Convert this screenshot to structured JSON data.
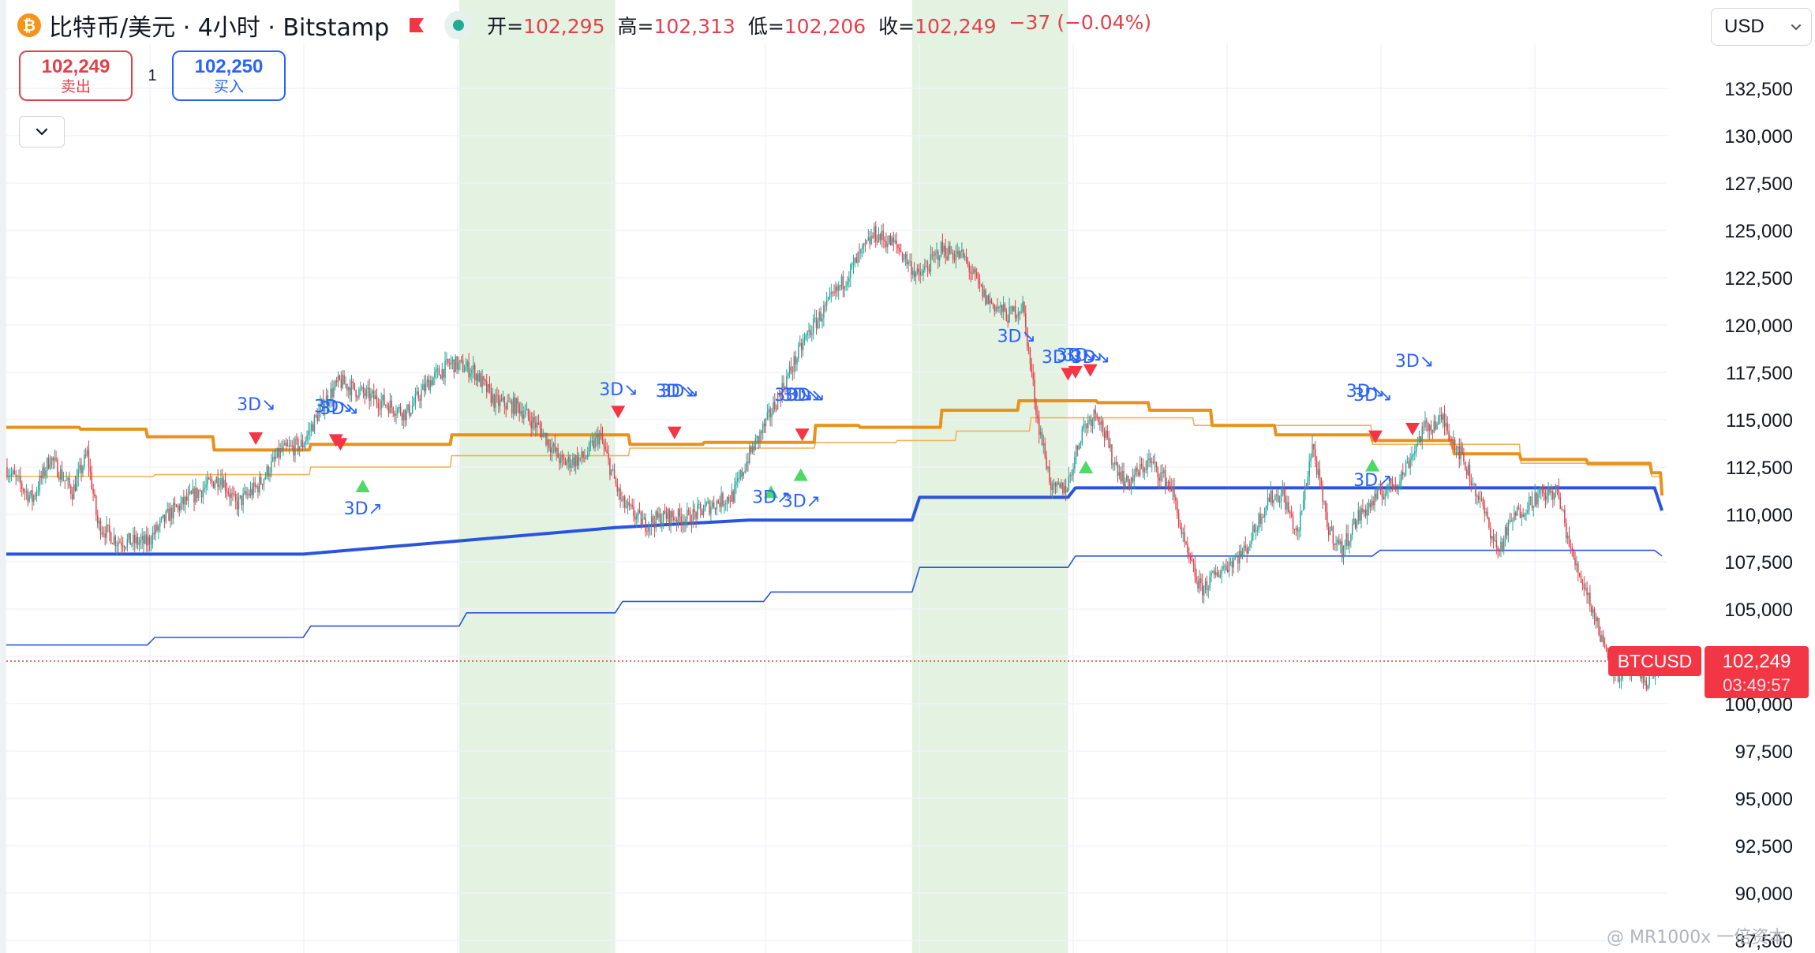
{
  "header": {
    "coin_icon": "bitcoin-icon",
    "title": "比特币/美元 · 4小时 · Bitstamp",
    "open_label": "开=",
    "open": "102,295",
    "high_label": "高=",
    "high": "102,313",
    "low_label": "低=",
    "low": "102,206",
    "close_label": "收=",
    "close": "102,249",
    "change": "−37 (−0.04%)"
  },
  "trade": {
    "sell_price": "102,249",
    "sell_label": "卖出",
    "spread": "1",
    "buy_price": "102,250",
    "buy_label": "买入"
  },
  "currency": "USD",
  "watermark": "@ MR1000x 一倍资本",
  "colors": {
    "up": "#26a69a",
    "down": "#e2404a",
    "orange": "#e8921c",
    "blue": "#2954e0",
    "highlight": "#e3f2e1"
  },
  "chart_data": {
    "type": "candlestick",
    "symbol": "BTCUSD",
    "y_axis_ticks": [
      "132,500",
      "130,000",
      "127,500",
      "125,000",
      "122,500",
      "120,000",
      "117,500",
      "115,000",
      "112,500",
      "110,000",
      "107,500",
      "105,000",
      "102,500",
      "100,000",
      "97,500",
      "95,000",
      "92,500",
      "90,000",
      "87,500"
    ],
    "ylim": [
      87500,
      133500
    ],
    "last_price": {
      "label": "BTCUSD",
      "value": "102,249",
      "countdown": "03:49:57",
      "price": 102249
    },
    "anchors": [
      [
        0,
        112500
      ],
      [
        18,
        110800
      ],
      [
        30,
        113000
      ],
      [
        45,
        111200
      ],
      [
        55,
        113200
      ],
      [
        62,
        109500
      ],
      [
        75,
        108600
      ],
      [
        95,
        108500
      ],
      [
        110,
        110000
      ],
      [
        130,
        111200
      ],
      [
        145,
        112000
      ],
      [
        155,
        110500
      ],
      [
        170,
        111500
      ],
      [
        185,
        113300
      ],
      [
        200,
        113700
      ],
      [
        215,
        116000
      ],
      [
        225,
        117000
      ],
      [
        240,
        116400
      ],
      [
        255,
        115900
      ],
      [
        270,
        115300
      ],
      [
        285,
        117000
      ],
      [
        300,
        118000
      ],
      [
        315,
        117600
      ],
      [
        330,
        115900
      ],
      [
        345,
        115700
      ],
      [
        360,
        114500
      ],
      [
        375,
        112700
      ],
      [
        390,
        113000
      ],
      [
        400,
        114200
      ],
      [
        415,
        110600
      ],
      [
        430,
        109500
      ],
      [
        445,
        109900
      ],
      [
        460,
        109800
      ],
      [
        475,
        110500
      ],
      [
        490,
        111000
      ],
      [
        500,
        113000
      ],
      [
        512,
        114800
      ],
      [
        525,
        117000
      ],
      [
        540,
        119500
      ],
      [
        555,
        121200
      ],
      [
        570,
        123000
      ],
      [
        585,
        124800
      ],
      [
        600,
        124200
      ],
      [
        615,
        122500
      ],
      [
        630,
        124000
      ],
      [
        645,
        123600
      ],
      [
        660,
        121400
      ],
      [
        675,
        120500
      ],
      [
        685,
        121000
      ],
      [
        695,
        115000
      ],
      [
        705,
        111200
      ],
      [
        715,
        111500
      ],
      [
        725,
        114500
      ],
      [
        735,
        115500
      ],
      [
        745,
        113000
      ],
      [
        755,
        111600
      ],
      [
        770,
        112800
      ],
      [
        785,
        111500
      ],
      [
        795,
        108000
      ],
      [
        805,
        106000
      ],
      [
        820,
        107200
      ],
      [
        835,
        108100
      ],
      [
        850,
        110800
      ],
      [
        860,
        111100
      ],
      [
        870,
        108800
      ],
      [
        880,
        113700
      ],
      [
        890,
        109400
      ],
      [
        900,
        108100
      ],
      [
        910,
        109800
      ],
      [
        925,
        111000
      ],
      [
        940,
        112000
      ],
      [
        955,
        114500
      ],
      [
        968,
        115000
      ],
      [
        980,
        113200
      ],
      [
        995,
        110300
      ],
      [
        1005,
        108000
      ],
      [
        1015,
        109800
      ],
      [
        1030,
        110900
      ],
      [
        1045,
        111200
      ],
      [
        1055,
        107800
      ],
      [
        1065,
        105900
      ],
      [
        1075,
        103400
      ],
      [
        1085,
        101500
      ],
      [
        1095,
        101800
      ],
      [
        1105,
        101200
      ],
      [
        1115,
        102249
      ]
    ],
    "orange_thick": [
      [
        0,
        114600
      ],
      [
        50,
        114500
      ],
      [
        95,
        114100
      ],
      [
        140,
        113400
      ],
      [
        205,
        113700
      ],
      [
        300,
        114200
      ],
      [
        420,
        113700
      ],
      [
        470,
        113800
      ],
      [
        545,
        114700
      ],
      [
        575,
        114600
      ],
      [
        630,
        115500
      ],
      [
        682,
        116000
      ],
      [
        735,
        115900
      ],
      [
        770,
        115500
      ],
      [
        812,
        114700
      ],
      [
        855,
        114200
      ],
      [
        920,
        113900
      ],
      [
        975,
        113200
      ],
      [
        1020,
        112900
      ],
      [
        1065,
        112700
      ],
      [
        1108,
        112200
      ],
      [
        1115,
        111000
      ]
    ],
    "orange_thin": [
      [
        0,
        112000
      ],
      [
        100,
        112100
      ],
      [
        150,
        112100
      ],
      [
        205,
        112500
      ],
      [
        300,
        113100
      ],
      [
        420,
        113500
      ],
      [
        545,
        113800
      ],
      [
        600,
        113900
      ],
      [
        640,
        114400
      ],
      [
        690,
        115100
      ],
      [
        740,
        115100
      ],
      [
        800,
        114700
      ],
      [
        920,
        113700
      ],
      [
        1020,
        112700
      ],
      [
        1065,
        112600
      ],
      [
        1108,
        112000
      ],
      [
        1115,
        111200
      ]
    ],
    "blue_thick": [
      [
        0,
        107900
      ],
      [
        200,
        107900
      ],
      [
        305,
        108600
      ],
      [
        410,
        109300
      ],
      [
        500,
        109700
      ],
      [
        610,
        109700
      ],
      [
        615,
        110900
      ],
      [
        715,
        110900
      ],
      [
        720,
        111400
      ],
      [
        1110,
        111400
      ],
      [
        1115,
        110200
      ]
    ],
    "blue_thin": [
      [
        0,
        103100
      ],
      [
        95,
        103100
      ],
      [
        100,
        103500
      ],
      [
        200,
        103500
      ],
      [
        205,
        104100
      ],
      [
        305,
        104100
      ],
      [
        310,
        104800
      ],
      [
        410,
        104800
      ],
      [
        415,
        105400
      ],
      [
        510,
        105400
      ],
      [
        515,
        105900
      ],
      [
        610,
        105900
      ],
      [
        615,
        107200
      ],
      [
        715,
        107200
      ],
      [
        720,
        107800
      ],
      [
        920,
        107800
      ],
      [
        925,
        108100
      ],
      [
        1110,
        108100
      ],
      [
        1115,
        107800
      ]
    ],
    "sell_signals": [
      [
        168,
        114000
      ],
      [
        222,
        113900
      ],
      [
        225,
        113700
      ],
      [
        412,
        115400
      ],
      [
        450,
        114300
      ],
      [
        536,
        114200
      ],
      [
        715,
        117400
      ],
      [
        720,
        117500
      ],
      [
        730,
        117600
      ],
      [
        922,
        114100
      ],
      [
        947,
        114500
      ]
    ],
    "buy_signals": [
      [
        240,
        111500
      ],
      [
        515,
        111200
      ],
      [
        535,
        112100
      ],
      [
        727,
        112500
      ],
      [
        920,
        112600
      ]
    ],
    "labels_down": [
      [
        168,
        115500
      ],
      [
        220,
        115400
      ],
      [
        224,
        115300
      ],
      [
        412,
        116300
      ],
      [
        450,
        116200
      ],
      [
        453,
        116200
      ],
      [
        530,
        116000
      ],
      [
        535,
        116000
      ],
      [
        538,
        116000
      ],
      [
        680,
        119100
      ],
      [
        710,
        118000
      ],
      [
        720,
        118100
      ],
      [
        725,
        118100
      ],
      [
        730,
        118000
      ],
      [
        915,
        116200
      ],
      [
        920,
        116000
      ],
      [
        948,
        117800
      ]
    ],
    "labels_up": [
      [
        240,
        110000
      ],
      [
        515,
        110600
      ],
      [
        535,
        110400
      ],
      [
        920,
        111500
      ]
    ],
    "highlights": [
      [
        305,
        410
      ],
      [
        610,
        715
      ]
    ]
  }
}
